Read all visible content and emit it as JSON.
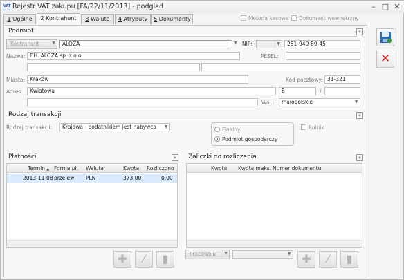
{
  "window": {
    "title": "Rejestr VAT zakupu [FA/22/11/2013] - podgląd",
    "app_icon_text": "VAT",
    "minimize_glyph": "–",
    "maximize_glyph": "□",
    "close_glyph": "✕"
  },
  "tabs": [
    {
      "key": "1",
      "rest": " Ogólne"
    },
    {
      "key": "2",
      "rest": " Kontrahent"
    },
    {
      "key": "3",
      "rest": " Waluta"
    },
    {
      "key": "4",
      "rest": " Atrybuty"
    },
    {
      "key": "5",
      "rest": " Dokumenty"
    }
  ],
  "header_checks": {
    "metoda_kasowa": "Metoda kasowa",
    "dokument_wewnetrzny": "Dokument wewnętrzny"
  },
  "podmiot": {
    "title": "Podmiot",
    "kontrahent_button": "Kontrahent",
    "kontrahent_code": "ALOZA",
    "nip_label": "NIP:",
    "nip": "281-949-89-45",
    "nazwa_label": "Nazwa:",
    "nazwa": "F.H. ALOZA sp. z o.o.",
    "pesel_label": "PESEL:",
    "miasto_label": "Miasto:",
    "miasto": "Kraków",
    "kod_label": "Kod pocztowy:",
    "kod": "31-321",
    "adres_label": "Adres:",
    "ulica": "Kwiatowa",
    "nr_domu": "8",
    "slash": "/",
    "woj_label": "Woj.:",
    "woj": "małopolskie"
  },
  "rodzaj": {
    "title": "Rodzaj transakcji",
    "label": "Rodzaj transakcji:",
    "value": "Krajowa - podatnikiem jest nabywca",
    "radio_finalny": "Finalny",
    "radio_podmiot": "Podmiot gospodarczy",
    "rolnik": "Rolnik"
  },
  "platnosci": {
    "title": "Płatności",
    "columns": [
      "Termin",
      "Forma pł.",
      "Waluta",
      "Kwota",
      "Rozliczono"
    ],
    "sort_glyph": "▲",
    "rows": [
      {
        "termin": "2013-11-08",
        "forma": "przelew",
        "waluta": "PLN",
        "kwota": "373,00",
        "rozliczono": "0,00"
      }
    ]
  },
  "zaliczki": {
    "title": "Zaliczki do rozliczenia",
    "columns": [
      "Kwota",
      "Kwota maks.",
      "Numer dokumentu"
    ],
    "pracownik_button": "Pracownik"
  },
  "icons": {
    "collapse": "«",
    "plus": "✚",
    "edit": "⁄",
    "delete": "▮",
    "dropdown": "▼",
    "save_close": "✕"
  },
  "colors": {
    "accent_blue": "#2f6bb5",
    "delete_red": "#d32323",
    "selected_row": "#dcebff"
  }
}
